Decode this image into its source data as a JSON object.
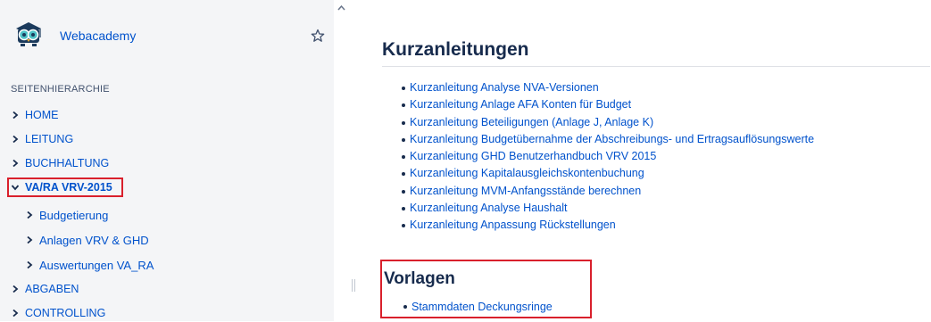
{
  "sidebar": {
    "space_name": "Webacademy",
    "section_label": "SEITENHIERARCHIE",
    "items": [
      {
        "label": "HOME"
      },
      {
        "label": "LEITUNG"
      },
      {
        "label": "BUCHHALTUNG"
      },
      {
        "label": "VA/RA VRV-2015"
      },
      {
        "label": "ABGABEN"
      },
      {
        "label": "CONTROLLING"
      }
    ],
    "sub_items": [
      {
        "label": "Budgetierung"
      },
      {
        "label": "Anlagen VRV & GHD"
      },
      {
        "label": "Auswertungen VA_RA"
      }
    ]
  },
  "main": {
    "heading1": "Kurzanleitungen",
    "links": [
      "Kurzanleitung Analyse NVA-Versionen",
      "Kurzanleitung Anlage AFA Konten für Budget",
      "Kurzanleitung Beteiligungen (Anlage J, Anlage K)",
      "Kurzanleitung Budgetübernahme der Abschreibungs- und Ertragsauflösungswerte",
      "Kurzanleitung GHD Benutzerhandbuch VRV 2015",
      "Kurzanleitung Kapitalausgleichskontenbuchung",
      "Kurzanleitung MVM-Anfangsstände berechnen",
      "Kurzanleitung Analyse Haushalt",
      "Kurzanleitung Anpassung Rückstellungen"
    ],
    "heading2": "Vorlagen",
    "links2": [
      "Stammdaten Deckungsringe"
    ]
  },
  "colors": {
    "link": "#0052cc",
    "heading": "#172b4d",
    "sidebar_bg": "#f4f5f7",
    "highlight_frame": "#d9202c"
  },
  "icons": {
    "logo": "graduation-owl-logo",
    "favorite": "star-outline-icon",
    "expand": "chevron-right-icon",
    "collapse": "chevron-down-icon"
  }
}
